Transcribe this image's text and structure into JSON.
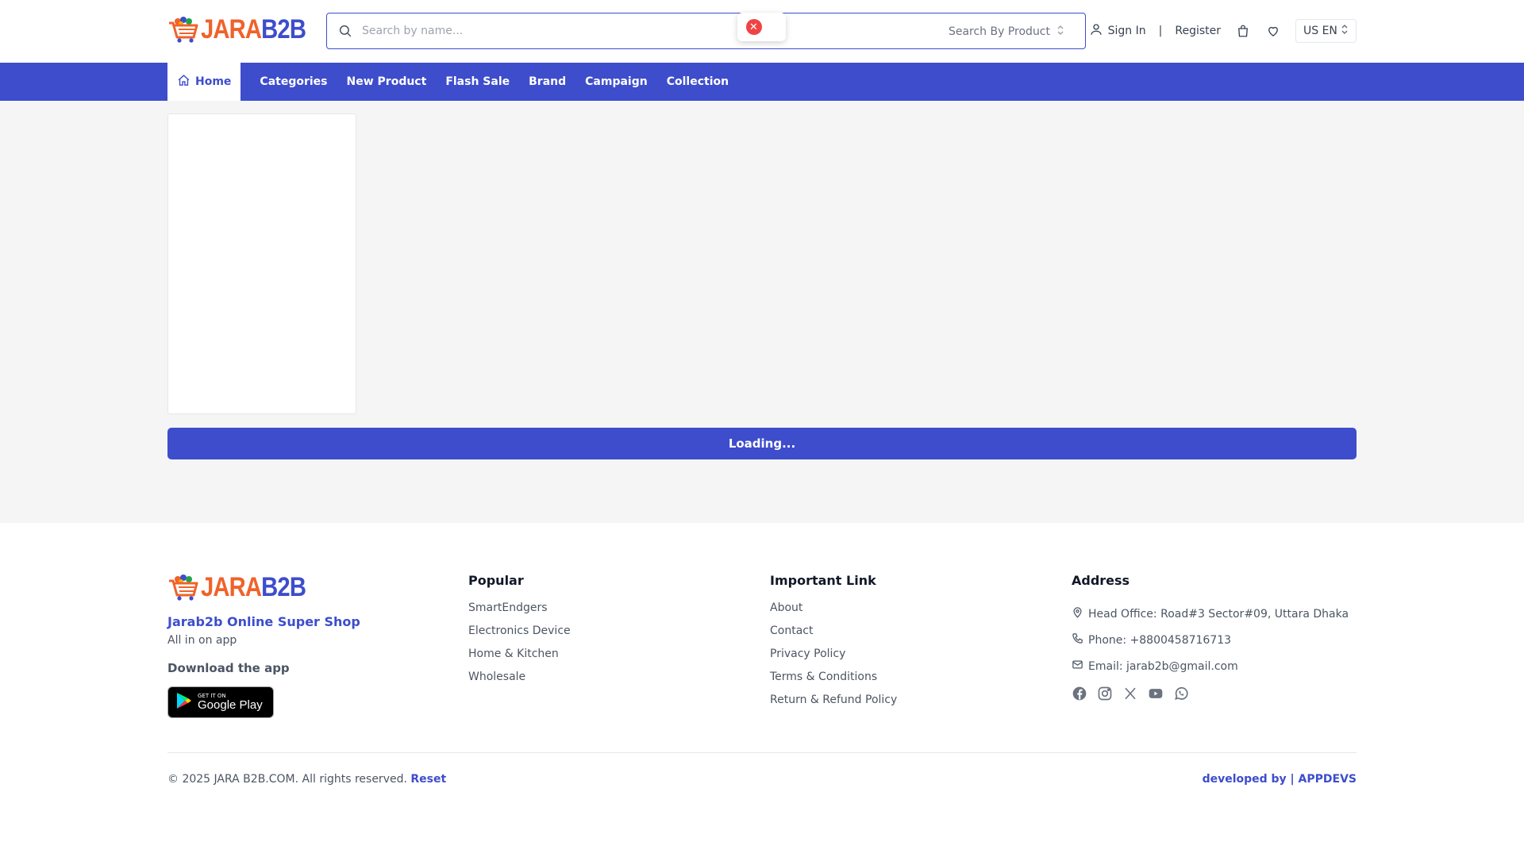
{
  "brand": {
    "logo_left": "JARA",
    "logo_right": "B2B"
  },
  "search": {
    "placeholder": "Search by name...",
    "scope": "Search By Product"
  },
  "header": {
    "sign_in": "Sign In",
    "separator": "|",
    "register": "Register",
    "language": "US EN"
  },
  "nav": {
    "items": [
      "Home",
      "Categories",
      "New Product",
      "Flash Sale",
      "Brand",
      "Campaign",
      "Collection"
    ]
  },
  "main": {
    "loading_label": "Loading..."
  },
  "footer": {
    "brand_title": "Jarab2b Online Super Shop",
    "brand_sub": "All in on app",
    "download_label": "Download the app",
    "gplay_small": "GET IT ON",
    "gplay_big": "Google Play",
    "popular": {
      "title": "Popular",
      "links": [
        "SmartEndgers",
        "Electronics Device",
        "Home & Kitchen",
        "Wholesale"
      ]
    },
    "important": {
      "title": "Important Link",
      "links": [
        "About",
        "Contact",
        "Privacy Policy",
        "Terms & Conditions",
        "Return & Refund Policy"
      ]
    },
    "address": {
      "title": "Address",
      "office": "Head Office: Road#3 Sector#09, Uttara Dhaka",
      "phone": "Phone: +8800458716713",
      "email": "Email: jarab2b@gmail.com"
    },
    "social_icons": [
      "facebook-icon",
      "instagram-icon",
      "x-icon",
      "youtube-icon",
      "whatsapp-icon"
    ],
    "copyright": "© 2025 JARA B2B.COM. All rights reserved.",
    "reset": "Reset",
    "developer": "developed by | APPDEVS"
  },
  "colors": {
    "primary": "#3d4dcc",
    "accent": "#f0622a",
    "error": "#ef4444",
    "main_bg": "#f5f5f5"
  }
}
